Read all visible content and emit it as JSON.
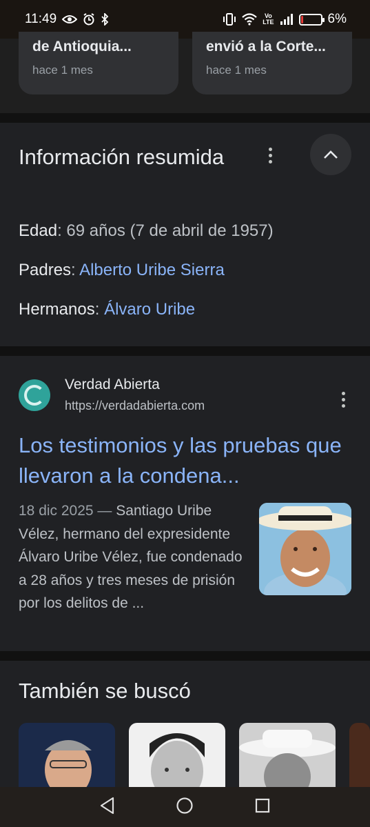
{
  "status_bar": {
    "time": "11:49",
    "battery_text": "6%",
    "battery_level": 0.06,
    "network_label_top": "Vo",
    "network_label_bottom": "LTE"
  },
  "news_cards": [
    {
      "title": "de Antioquia...",
      "date": "hace 1 mes"
    },
    {
      "title": "envió a la Corte...",
      "date": "hace 1 mes"
    }
  ],
  "summary": {
    "title": "Información resumida",
    "rows": [
      {
        "key": "Edad",
        "sep": ": ",
        "value": "69 años (7 de abril de 1957)"
      },
      {
        "key": "Padres",
        "sep": ": ",
        "value": "Alberto Uribe Sierra"
      },
      {
        "key": "Hermanos",
        "sep": ": ",
        "value": "Álvaro Uribe"
      }
    ]
  },
  "result": {
    "site_name": "Verdad Abierta",
    "site_url": "https://verdadabierta.com",
    "title": "Los testimonios y las pruebas que llevaron a la condena...",
    "date": "18 dic 2025 —",
    "snippet": " Santiago Uribe Vélez, hermano del expresidente Álvaro Uribe Vélez, fue condenado a 28 años y tres meses de prisión por los delitos de ..."
  },
  "also_searched": {
    "title": "También se buscó"
  },
  "colors": {
    "background": "#1f1f1f",
    "card": "#303134",
    "link": "#8ab4f8",
    "text": "#e8eaed",
    "muted": "#bdc1c6"
  },
  "icons": [
    "eye-icon",
    "alarm-icon",
    "bluetooth-icon",
    "vibrate-icon",
    "wifi-icon",
    "signal-icon",
    "battery-icon",
    "more-vert-icon",
    "chevron-up-icon",
    "back-icon",
    "home-icon",
    "recents-icon"
  ]
}
